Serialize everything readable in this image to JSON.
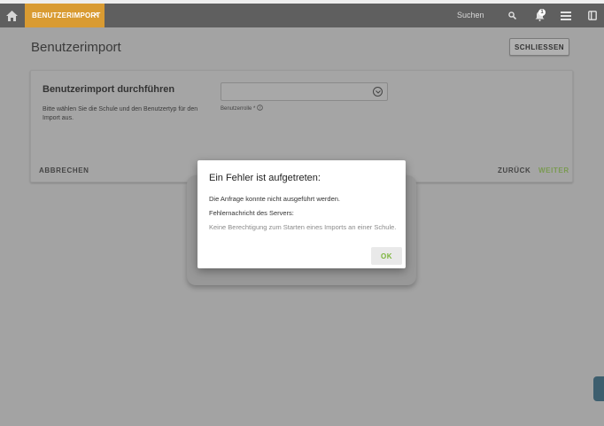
{
  "topbar": {
    "tab_label": "BENUTZERIMPORT",
    "tab_close": "×",
    "search_label": "Suchen",
    "notification_count": "1"
  },
  "page": {
    "title": "Benutzerimport",
    "close_button": "SCHLIESSEN"
  },
  "card": {
    "title": "Benutzerimport durchführen",
    "description": "Bitte wählen Sie die Schule und den Benutzertyp für den Import aus.",
    "role_label": "Benutzerrolle *",
    "role_value": "",
    "cancel_label": "ABBRECHEN",
    "back_label": "ZURÜCK",
    "next_label": "WEITER"
  },
  "dialog": {
    "title": "Ein Fehler ist aufgetreten:",
    "message": "Die Anfrage konnte nicht ausgeführt werden.",
    "server_label": "Fehlernachricht des Servers:",
    "server_error": "Keine Berechtigung zum Starten eines Imports an einer Schule.",
    "ok_label": "OK"
  },
  "colors": {
    "accent": "#d99b32",
    "ok_green": "#7bb53b",
    "topbar": "#5f5f5f",
    "overlay": "#a3a3a3"
  },
  "icons": [
    "home-icon",
    "close-icon",
    "search-icon",
    "bell-icon",
    "menu-icon",
    "book-icon",
    "chevron-down-icon",
    "help-icon"
  ]
}
